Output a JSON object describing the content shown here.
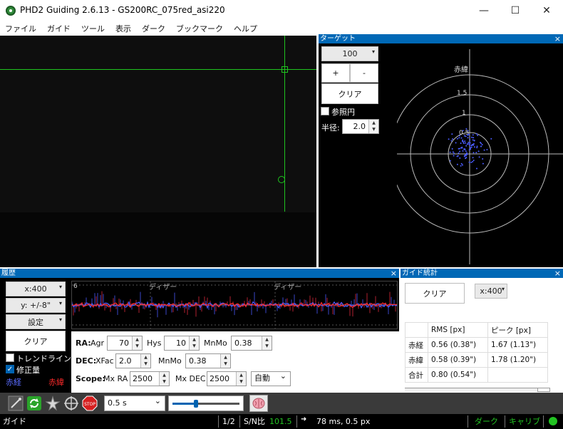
{
  "window": {
    "title": "PHD2 Guiding 2.6.13 - GS200RC_075red_asi220",
    "minimize": "—",
    "maximize": "☐",
    "close": "✕"
  },
  "menu": [
    "ファイル",
    "ガイド",
    "ツール",
    "表示",
    "ダーク",
    "ブックマーク",
    "ヘルプ"
  ],
  "target": {
    "title": "ターゲット",
    "close": "×",
    "scale": "100",
    "plus": "+",
    "minus": "-",
    "clear": "クリア",
    "ref_circle_label": "参照円",
    "radius_label": "半径:",
    "radius_value": "2.0",
    "dec_axis_label": "赤緯",
    "ra_axis_label": "赤経",
    "ring_labels": [
      "1.5",
      "1",
      "0.5"
    ]
  },
  "history": {
    "title": "履歴",
    "close": "×",
    "x_scale": "x:400",
    "y_scale": "y: +/-8\"",
    "settings": "設定",
    "clear": "クリア",
    "trend_label": "トレンドライン",
    "correction_label": "修正量",
    "legend_ra": "赤経",
    "legend_dec": "赤緯",
    "graph_top_label": "6",
    "dither_labels": [
      "ディザー",
      "ディザー"
    ],
    "ra_label": "RA:",
    "agr_label": "Agr",
    "agr_value": "70",
    "hys_label": "Hys",
    "hys_value": "10",
    "mnmo_label": "MnMo",
    "ra_mnmo_value": "0.38",
    "dec_label": "DEC:",
    "xfac_label": "XFac",
    "xfac_value": "2.0",
    "dec_mnmo_value": "0.38",
    "scope_label": "Scope:",
    "mxra_label": "Mx RA",
    "mxra_value": "2500",
    "mxdec_label": "Mx DEC",
    "mxdec_value": "2500",
    "mode_value": "自動"
  },
  "stats": {
    "title": "ガイド統計",
    "close": "×",
    "clear": "クリア",
    "x_scale": "x:400",
    "headers": [
      "",
      "RMS [px]",
      "ピーク [px]"
    ],
    "rows": [
      [
        "赤経",
        "0.56 (0.38\")",
        "1.67 (1.13\")"
      ],
      [
        "赤緯",
        "0.58 (0.39\")",
        "1.78 (1.20\")"
      ],
      [
        "合計",
        "0.80 (0.54\")",
        ""
      ]
    ]
  },
  "toolbar": {
    "exposure": "0.5 s",
    "exposure_fraction": 0.35
  },
  "status": {
    "mode": "ガイド",
    "page": "1/2",
    "snr_label": "S/N比",
    "snr_value": "101.5",
    "guide_info": "78 ms, 0.5 px",
    "dark": "ダーク",
    "calib": "キャリブ"
  },
  "colors": {
    "panel_title": "#0068b6",
    "ra": "#4a5cff",
    "dec": "#ff2a2a",
    "crosshair": "#1fc41f",
    "status_green": "#22c322"
  }
}
